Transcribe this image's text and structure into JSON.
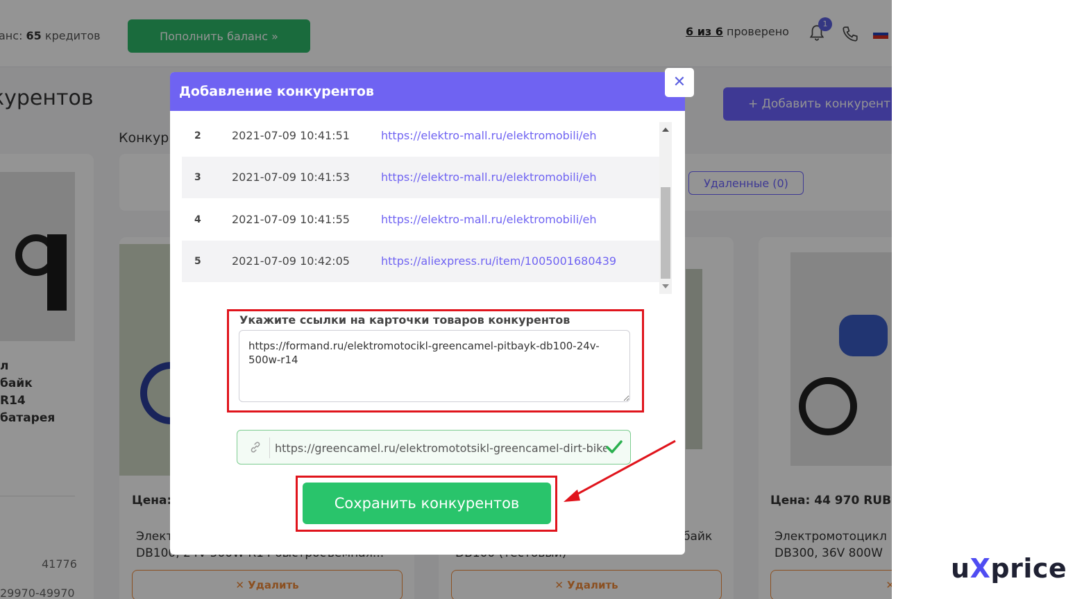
{
  "header": {
    "balance_label": "анс:",
    "balance_value": "65",
    "balance_unit": "кредитов",
    "topup_button": "Пополнить баланс »",
    "checked_count": "6 из 6",
    "checked_label": "проверено",
    "notification_count": "1"
  },
  "page": {
    "heading": "курентов",
    "add_competitor_button": "+ Добавить конкурент",
    "competitors_label": "Конкур",
    "deleted_button": "Удаленные (0)"
  },
  "cards": {
    "c1_line1": "л",
    "c1_line2": "байк",
    "c1_line3": "R14",
    "c1_line4": "батарея",
    "c1_num1": "41776",
    "c1_num2": "29970-49970",
    "c2_price": "Цена:",
    "c2_title1": "Элект",
    "c2_title2": "DB100, 24V 500W R14 быстросъемная...",
    "c3_title1": "байк",
    "c3_title2": "DB100 (тестовый)",
    "c4_price": "Цена: 44 970 RUB |",
    "c4_title1": "Электромотоцикл",
    "c4_title2": "DB300, 36V 800W",
    "delete_label": "✕ Удалить",
    "delete_icon_only": "✕"
  },
  "modal": {
    "title": "Добавление конкурентов",
    "close": "✕",
    "rows": [
      {
        "num": "2",
        "date": "2021-07-09 10:41:51",
        "url": "https://elektro-mall.ru/elektromobili/eh"
      },
      {
        "num": "3",
        "date": "2021-07-09 10:41:53",
        "url": "https://elektro-mall.ru/elektromobili/eh"
      },
      {
        "num": "4",
        "date": "2021-07-09 10:41:55",
        "url": "https://elektro-mall.ru/elektromobili/eh"
      },
      {
        "num": "5",
        "date": "2021-07-09 10:42:05",
        "url": "https://aliexpress.ru/item/1005001680439"
      }
    ],
    "links_label": "Укажите ссылки на карточки товаров конкурентов",
    "links_value": "https://formand.ru/elektromotocikl-greencamel-pitbayk-db100-24v-500w-r14",
    "url_value": "https://greencamel.ru/elektromototsikl-greencamel-dirt-bike",
    "save_button": "Сохранить конкурентов"
  },
  "brand": {
    "prefix": "u",
    "x": "X",
    "suffix": "price"
  },
  "colors": {
    "accent": "#6f63f2",
    "success": "#29c46b",
    "highlight": "#e0141c"
  }
}
